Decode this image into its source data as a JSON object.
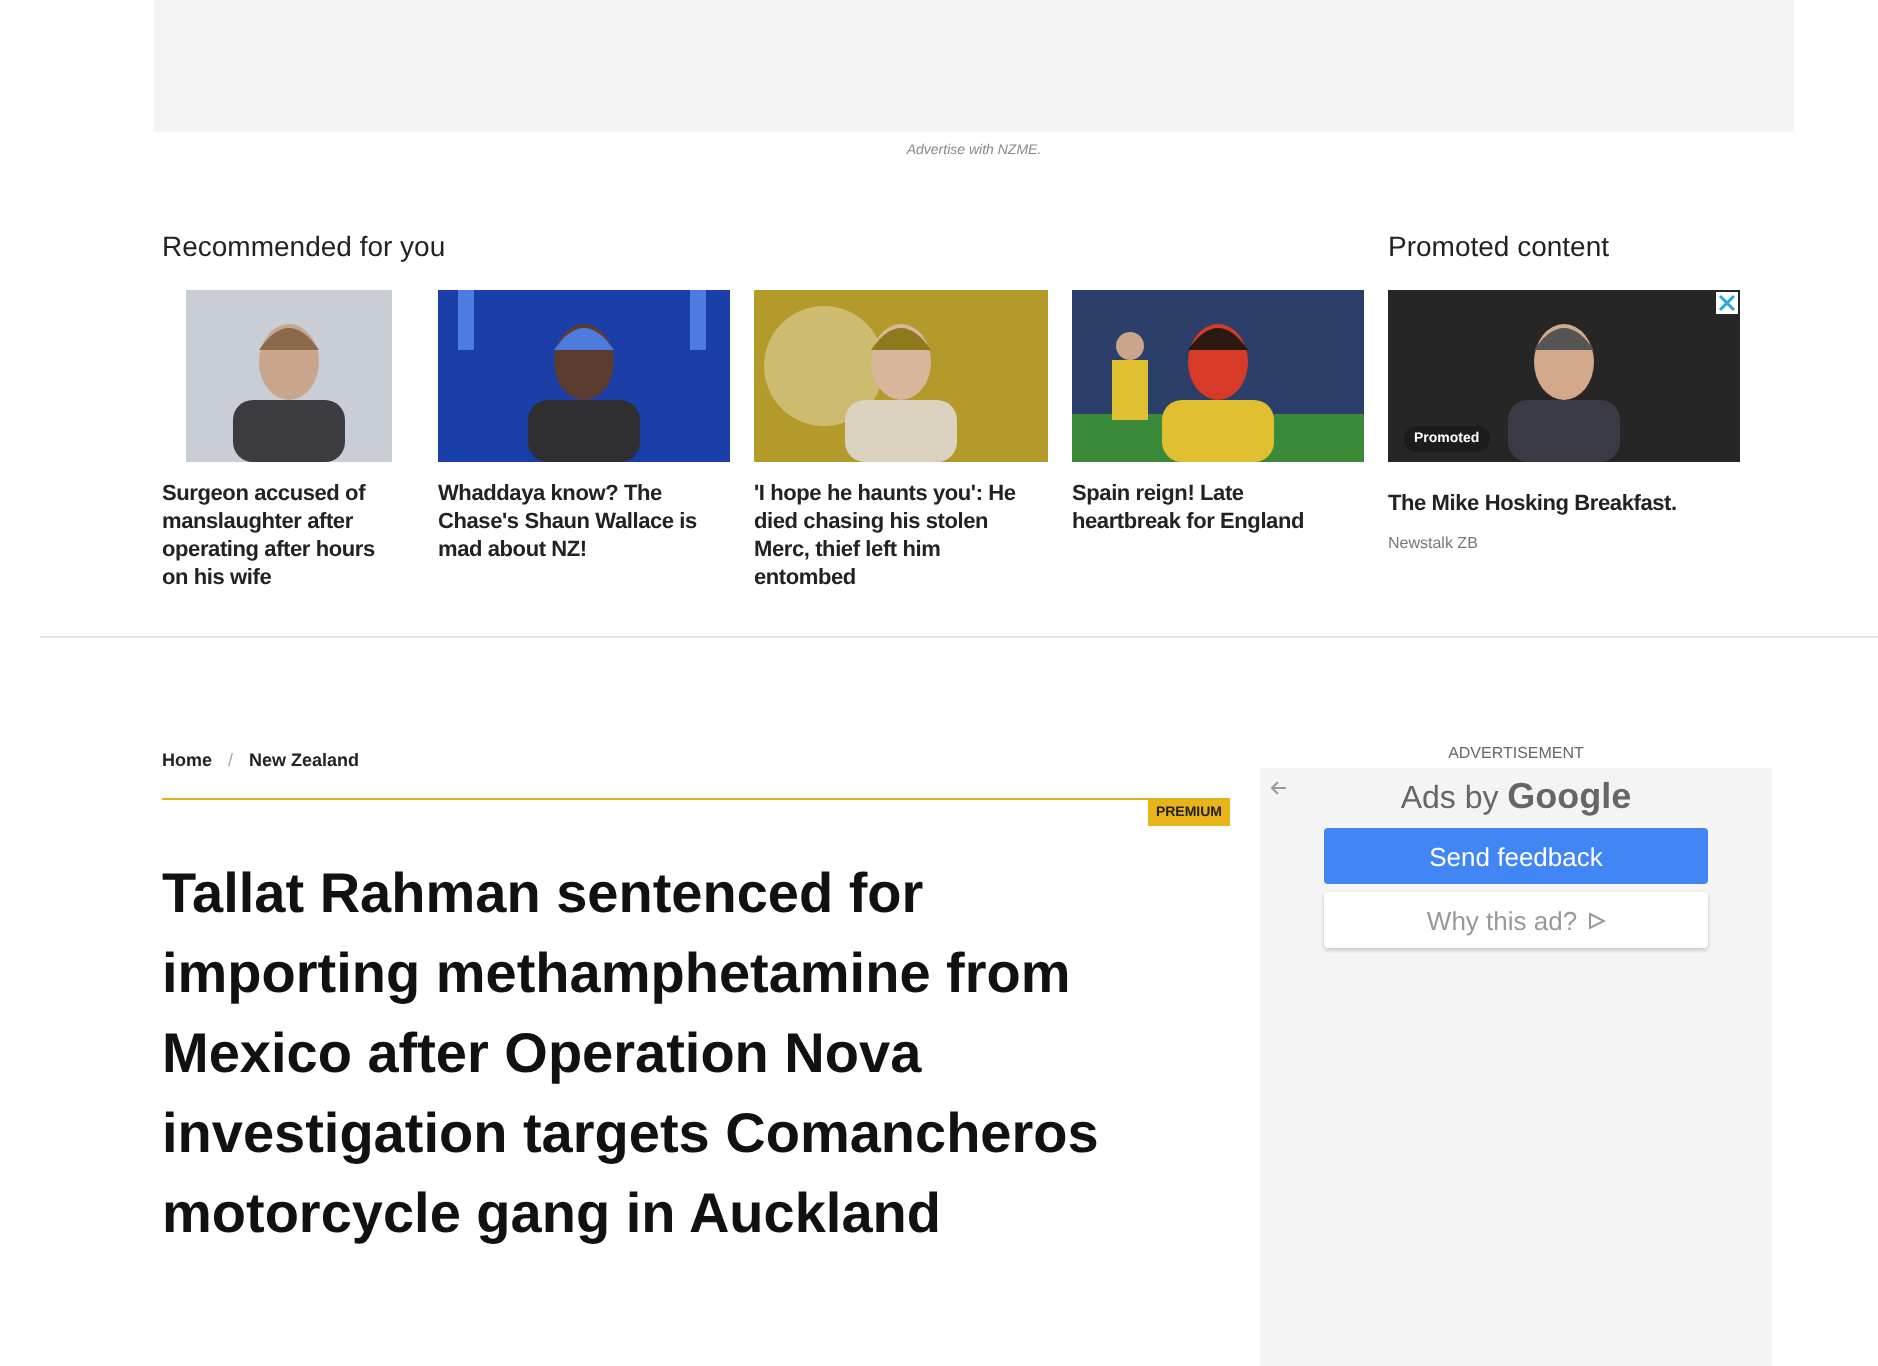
{
  "top_ad": {
    "caption": "Advertise with NZME."
  },
  "recommended": {
    "heading": "Recommended for you",
    "items": [
      {
        "title": "Surgeon accused of manslaughter after operating after hours on his wife"
      },
      {
        "title": "Whaddaya know? The Chase's Shaun Wallace is mad about NZ!"
      },
      {
        "title": "'I hope he haunts you': He died chasing his stolen Merc, thief left him entombed"
      },
      {
        "title": "Spain reign! Late heartbreak for England"
      }
    ]
  },
  "promoted": {
    "heading": "Promoted content",
    "badge": "Promoted",
    "title": "The Mike Hosking Breakfast.",
    "source": "Newstalk ZB"
  },
  "breadcrumb": {
    "items": [
      "Home",
      "New Zealand"
    ],
    "separator": "/"
  },
  "article": {
    "badge": "PREMIUM",
    "headline": "Tallat Rahman sentenced for importing methamphetamine from Mexico after Operation Nova investigation targets Comancheros motorcycle gang in Auckland"
  },
  "ad_panel": {
    "label": "ADVERTISEMENT",
    "ads_by": "Ads by **Google**",
    "buttons": [
      {
        "label": "Send feedback",
        "kind": "primary"
      },
      {
        "label": "Why this ad?",
        "kind": "secondary"
      }
    ]
  }
}
